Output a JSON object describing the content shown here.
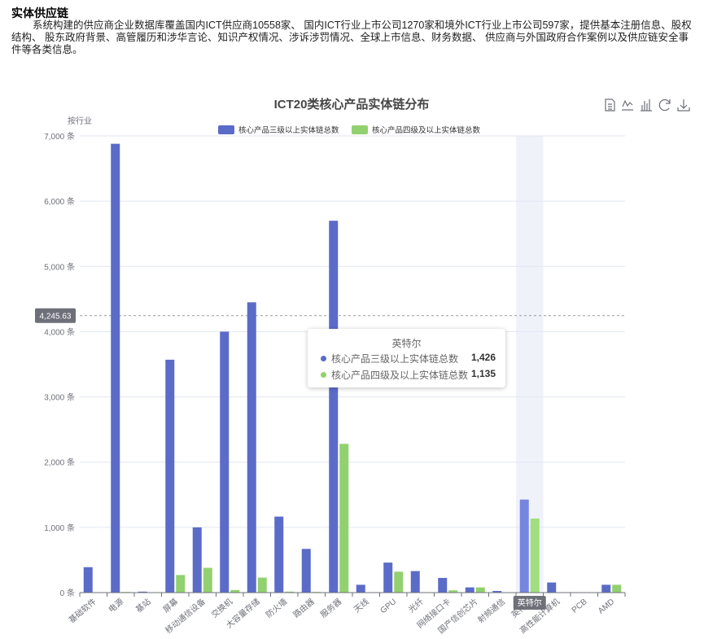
{
  "page": {
    "heading": "实体供应链",
    "description": "系统构建的供应商企业数据库覆盖国内ICT供应商10558家、 国内ICT行业上市公司1270家和境外ICT行业上市公司597家，提供基本注册信息、股权结构、 股东政府背景、高管履历和涉华言论、知识产权情况、涉诉涉罚情况、全球上市信息、财务数据、 供应商与外国政府合作案例以及供应链安全事件等各类信息。"
  },
  "toolbox": [
    "data-view-icon",
    "line-chart-icon",
    "bar-chart-icon",
    "restore-icon",
    "download-icon"
  ],
  "tooltip": {
    "title": "英特尔",
    "rows": [
      {
        "name": "核心产品三级以上实体链总数",
        "value": "1,426"
      },
      {
        "name": "核心产品四级及以上实体链总数",
        "value": "1,135"
      }
    ]
  },
  "chart_data": {
    "type": "bar",
    "title": "ICT20类核心产品实体链分布",
    "ylabel": "按行业",
    "ylim": [
      0,
      7000
    ],
    "yticks": [
      0,
      1000,
      2000,
      3000,
      4000,
      5000,
      6000,
      7000
    ],
    "ytick_suffix": " 条",
    "legend_position": "top",
    "grid": true,
    "pointer_value_label": "4,245.63",
    "hovered_category": "英特尔",
    "categories": [
      "基础软件",
      "电源",
      "基站",
      "屏幕",
      "移动通信设备",
      "交换机",
      "大容量存储",
      "防火墙",
      "路由器",
      "服务器",
      "天线",
      "GPU",
      "光纤",
      "网络接口卡",
      "国产信创芯片",
      "射频通信",
      "英特尔",
      "高性能计算机",
      "PCB",
      "AMD"
    ],
    "series": [
      {
        "name": "核心产品三级以上实体链总数",
        "color": "#5b6bc8",
        "values": [
          390,
          6880,
          15,
          3570,
          1000,
          4000,
          4450,
          1165,
          670,
          5700,
          120,
          460,
          330,
          225,
          80,
          25,
          1426,
          155,
          0,
          120
        ]
      },
      {
        "name": "核心产品四级及以上实体链总数",
        "color": "#92d16f",
        "values": [
          0,
          10,
          0,
          270,
          380,
          40,
          230,
          15,
          10,
          2280,
          0,
          320,
          0,
          35,
          80,
          0,
          1135,
          0,
          0,
          120
        ]
      }
    ]
  }
}
